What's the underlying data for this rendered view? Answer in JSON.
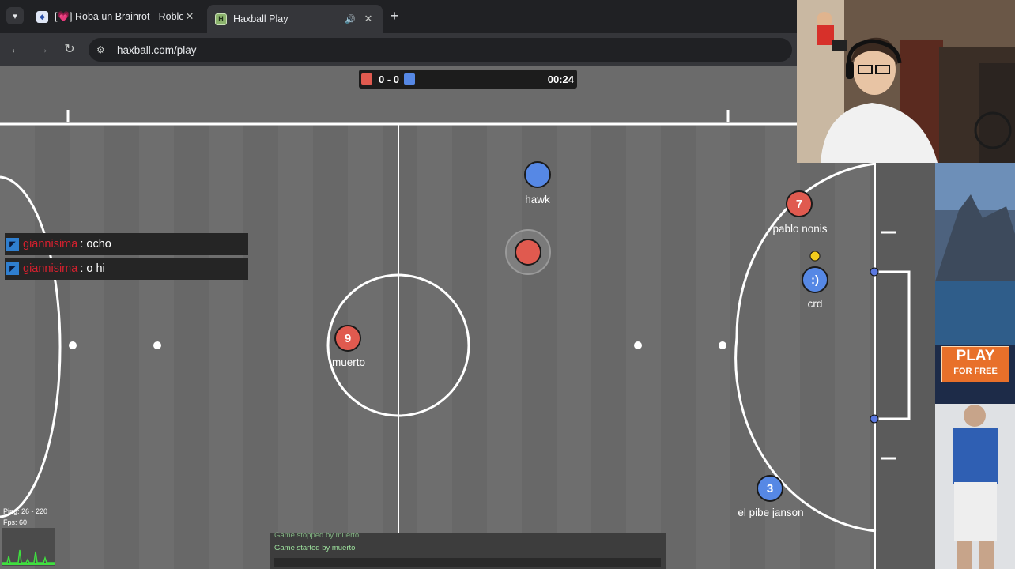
{
  "browser": {
    "tabs": [
      {
        "title": "[💗] Roba un Brainrot - Roblox",
        "favicon": "roblox-icon",
        "active": false
      },
      {
        "title": "Haxball Play",
        "favicon": "haxball-icon",
        "active": true,
        "audio": true
      }
    ],
    "url": "haxball.com/play"
  },
  "scoreboard": {
    "score": "0 - 0",
    "time": "00:24",
    "red_color": "#e05a4f",
    "blue_color": "#5688e5"
  },
  "players": [
    {
      "name": "hawk",
      "team": "blue",
      "avatar": ""
    },
    {
      "name": "",
      "team": "red",
      "avatar": "",
      "note": "controlled-player"
    },
    {
      "name": "pablo nonis",
      "team": "red",
      "avatar": "7"
    },
    {
      "name": "crd",
      "team": "blue",
      "avatar": ":)"
    },
    {
      "name": "muerto",
      "team": "red",
      "avatar": "9"
    },
    {
      "name": "el pibe janson",
      "team": "blue",
      "avatar": "3"
    }
  ],
  "chat": [
    {
      "user": "giannisima",
      "message": ": ocho"
    },
    {
      "user": "giannisima",
      "message": ": o hi"
    }
  ],
  "stats": {
    "ping": "Ping: 26 - 220",
    "fps": "Fps: 60"
  },
  "console": [
    "Game stopped by muerto",
    "Game started by muerto"
  ],
  "ad": {
    "play_label": "PLAY",
    "free_label": "FOR FREE"
  }
}
